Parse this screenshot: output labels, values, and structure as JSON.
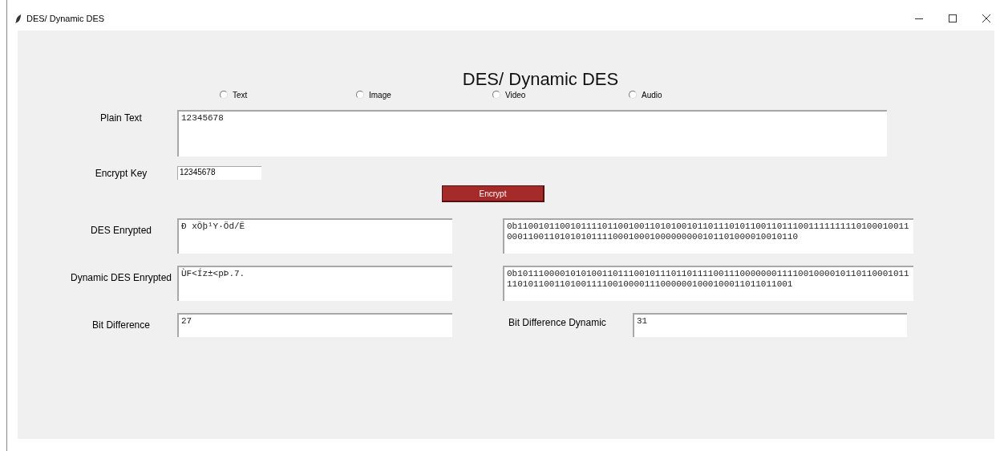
{
  "window": {
    "title": "DES/ Dynamic DES"
  },
  "heading": "DES/ Dynamic DES",
  "input_types": [
    {
      "label": "Text",
      "selected": false
    },
    {
      "label": "Image",
      "selected": false
    },
    {
      "label": "Video",
      "selected": false
    },
    {
      "label": "Audio",
      "selected": false
    }
  ],
  "plain_text": {
    "label": "Plain Text",
    "value": "12345678"
  },
  "encrypt_key": {
    "label": "Encrypt Key",
    "value": "12345678"
  },
  "encrypt_button": "Encrypt",
  "des_encrypted": {
    "label": "DES Enrypted",
    "value": "Ð xÕþ¹Y·Öd/Ë",
    "binary": "0b110010110010111101100100110101001011011101011001101110011111111101000100110001100110101010111100010001000000000101101000010010110"
  },
  "dynamic_encrypted": {
    "label": "Dynamic DES Enrypted",
    "value": "ÙF<Íz±<pÞ.7.",
    "binary": "0b10111000010101001101110010111011011110011100000001111001000010110110001011110101100110100111100100001110000001000100011011011001"
  },
  "bit_difference": {
    "label": "Bit Difference",
    "value": "27"
  },
  "bit_difference_dynamic": {
    "label": "Bit Difference Dynamic",
    "value": "31"
  }
}
